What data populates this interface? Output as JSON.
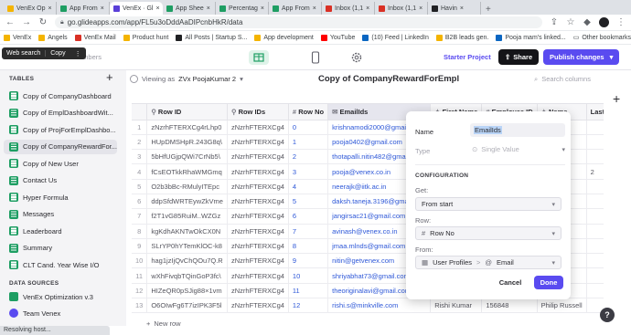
{
  "browser": {
    "tabs": [
      {
        "label": "VenEx Op",
        "color": "#f4b400"
      },
      {
        "label": "App From",
        "color": "#1e9e63"
      },
      {
        "label": "VenEx · Gl",
        "color": "#5a3fd8",
        "active": true
      },
      {
        "label": "App Shee",
        "color": "#1e9e63"
      },
      {
        "label": "Percentag",
        "color": "#1e9e63"
      },
      {
        "label": "App From",
        "color": "#1e9e63"
      },
      {
        "label": "Inbox (1,1",
        "color": "#d93025"
      },
      {
        "label": "Inbox (1,1",
        "color": "#d93025"
      },
      {
        "label": "Havin",
        "color": "#202124"
      }
    ],
    "url": "go.glideapps.com/app/FL5u3oDddAaDIPcnbHkR/data",
    "bookmarks": [
      {
        "label": "VenEx",
        "color": "#f4b400"
      },
      {
        "label": "Angels",
        "color": "#f4b400"
      },
      {
        "label": "VenEx Mail",
        "color": "#d93025"
      },
      {
        "label": "Product hunt",
        "color": "#f4b400"
      },
      {
        "label": "All Posts | Startup S...",
        "color": "#202124"
      },
      {
        "label": "App development",
        "color": "#f4b400"
      },
      {
        "label": "YouTube",
        "color": "#ff0000"
      },
      {
        "label": "(10) Feed | LinkedIn",
        "color": "#0a66c2"
      },
      {
        "label": "B2B leads gen.",
        "color": "#f4b400"
      },
      {
        "label": "Pooja mam's linked...",
        "color": "#0a66c2"
      }
    ],
    "other_bookmarks": "Other bookmarks",
    "status_text": "Resolving host..."
  },
  "tooltip": {
    "web_search": "Web search",
    "copy": "Copy"
  },
  "app_header": {
    "team_members": "team members",
    "viewing_as": "Viewing as",
    "viewer": "ZVx PoojaKumar 2",
    "starter_project": "Starter Project",
    "share": "Share",
    "publish": "Publish changes"
  },
  "sidebar": {
    "tables_heading": "TABLES",
    "items": [
      "Copy of CompanyDashboard",
      "Copy of EmplDashboardWit...",
      "Copy of ProjForEmplDashbo...",
      "Copy of CompanyRewardFor...",
      "Copy of New User",
      "Contact Us",
      "Hyper Formula",
      "Messages",
      "Leaderboard",
      "Summary",
      "CLT Cand. Year Wise I/O"
    ],
    "selected_index": 3,
    "data_sources_heading": "DATA SOURCES",
    "sources": [
      "VenEx Optimization v.3",
      "Team Venex"
    ]
  },
  "table": {
    "title": "Copy of CompanyRewardForEmpl",
    "search_placeholder": "Search columns",
    "columns": [
      "",
      "Row ID",
      "Row IDs",
      "Row No",
      "EmailIds",
      "First Name",
      "Employee ID",
      "Name",
      "Last"
    ],
    "rows": [
      [
        "1",
        "zNzrhFTERXCg4rLhp0",
        "zNzrhFTERXCg4",
        "0",
        "krishnamodi2000@gmail.com",
        "",
        "",
        "",
        ""
      ],
      [
        "2",
        "HUpDMSHpR.243G8q\\",
        "zNzrhFTERXCg4",
        "1",
        "pooja0402@gmail.com",
        "",
        "",
        "",
        ""
      ],
      [
        "3",
        "5bHfUGjpQWi7CrNb5\\",
        "zNzrhFTERXCg4",
        "2",
        "thotapalli.nitin482@gmail.com",
        "",
        "",
        "",
        ""
      ],
      [
        "4",
        "fCsEOTkkRhaWMGmq",
        "zNzrhFTERXCg4",
        "3",
        "pooja@venex.co.in",
        "",
        "",
        "",
        "2"
      ],
      [
        "5",
        "O2b3bBc-RMulyITEpc",
        "zNzrhFTERXCg4",
        "4",
        "neerajk@iitk.ac.in",
        "",
        "",
        "",
        ""
      ],
      [
        "6",
        "ddpSfdWRTEywZkVme",
        "zNzrhFTERXCg4",
        "5",
        "daksh.taneja.3196@gmail.com",
        "",
        "",
        "",
        ""
      ],
      [
        "7",
        "f2T1vG85RuiM..WZGz",
        "zNzrhFTERXCg4",
        "6",
        "jangirsac21@gmail.com",
        "",
        "",
        "",
        ""
      ],
      [
        "8",
        "kgKdhAKNTwOkCX0N",
        "zNzrhFTERXCg4",
        "7",
        "avinash@venex.co.in",
        "",
        "",
        "",
        ""
      ],
      [
        "9",
        "SLrYP0hYTemKlOC-k8",
        "zNzrhFTERXCg4",
        "8",
        "jmaa.mlnds@gmail.com",
        "",
        "",
        "",
        ""
      ],
      [
        "10",
        "hag1jzIjQvChQOu7Q.R",
        "zNzrhFTERXCg4",
        "9",
        "nitin@getvenex.com",
        "",
        "",
        "",
        ""
      ],
      [
        "11",
        "wXhFivqbTQinGoP3fc\\",
        "zNzrhFTERXCg4",
        "10",
        "shriyabhat73@gmail.com",
        "",
        "",
        "",
        ""
      ],
      [
        "12",
        "HIZeQR0pSJig88×1vm",
        "zNzrhFTERXCg4",
        "11",
        "theoriginalavi@gmail.com",
        "",
        "",
        "",
        ""
      ],
      [
        "13",
        "O6OIwFg6T7izIPK3F5l",
        "zNzrhFTERXCg4",
        "12",
        "rishi.s@minkville.com",
        "Rishi Kumar",
        "156848",
        "Philip Russell",
        ""
      ]
    ],
    "new_row": "New row"
  },
  "dialog": {
    "name_label": "Name",
    "name_value": "EmailIds",
    "type_label": "Type",
    "type_value": "Single Value",
    "configuration": "CONFIGURATION",
    "get_label": "Get:",
    "get_value": "From start",
    "row_label": "Row:",
    "row_value": "Row No",
    "from_label": "From:",
    "from_table": "User Profiles",
    "from_separator": ">",
    "from_column": "Email",
    "cancel": "Cancel",
    "done": "Done"
  },
  "colors": {
    "accent": "#5a4bf0",
    "glide_green": "#1e9e63",
    "link": "#2e58d8"
  }
}
